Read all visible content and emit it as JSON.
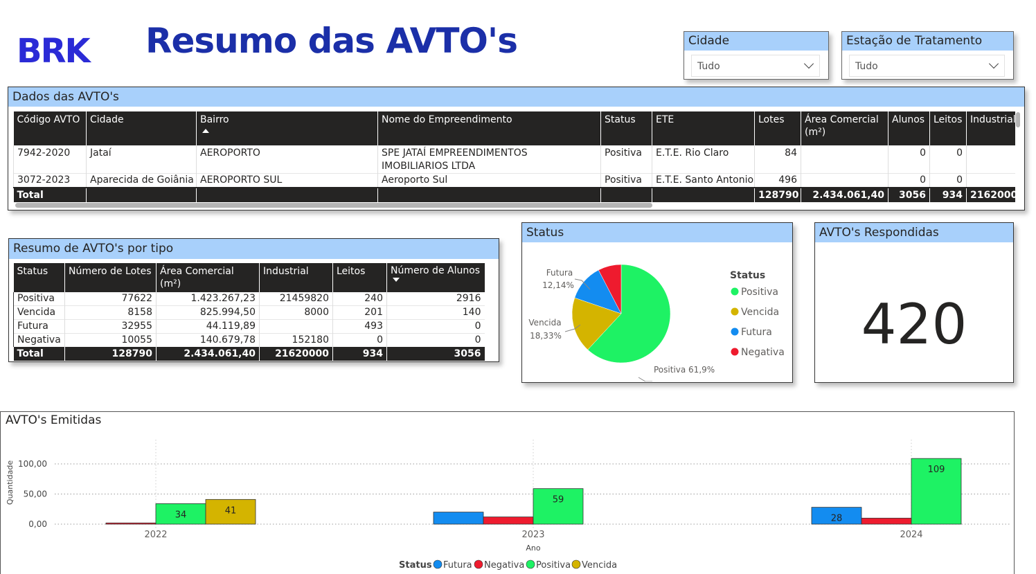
{
  "header": {
    "logo_text": "BRK",
    "title": "Resumo das AVTO's"
  },
  "slicers": {
    "cidade": {
      "label": "Cidade",
      "value": "Tudo"
    },
    "estacao": {
      "label": "Estação de Tratamento",
      "value": "Tudo"
    }
  },
  "colors": {
    "title_blue": "#1b2fa8",
    "header_bg": "#a8d0fb",
    "positiva": "#1ef264",
    "vencida": "#d4b400",
    "futura": "#138cf0",
    "negativa": "#ee1b2e"
  },
  "dados": {
    "title": "Dados das AVTO's",
    "columns": [
      "Código AVTO",
      "Cidade",
      "Bairro",
      "Nome do Empreendimento",
      "Status",
      "ETE",
      "Lotes",
      "Área Comercial (m²)",
      "Alunos",
      "Leitos",
      "Industrial"
    ],
    "rows": [
      [
        "7942-2020",
        "Jataí",
        "AEROPORTO",
        "SPE JATAÍ EMPREENDIMENTOS",
        "IMOBILIARIOS LTDA",
        "Positiva",
        "E.T.E. Rio Claro",
        "84",
        "",
        "0",
        "0",
        ""
      ],
      [
        "3072-2023",
        "Aparecida de Goiânia",
        "AEROPORTO SUL",
        "Aeroporto Sul",
        "",
        "Positiva",
        "E.T.E. Santo Antonio",
        "496",
        "",
        "0",
        "0",
        ""
      ]
    ],
    "total": [
      "Total",
      "",
      "",
      "",
      "",
      "",
      "128790",
      "2.434.061,40",
      "3056",
      "934",
      "2162000"
    ]
  },
  "resumo": {
    "title": "Resumo de AVTO's por tipo",
    "columns": [
      "Status",
      "Número de Lotes",
      "Área Comercial (m²)",
      "Industrial",
      "Leitos",
      "Número de Alunos"
    ],
    "rows": [
      [
        "Positiva",
        "77622",
        "1.423.267,23",
        "21459820",
        "240",
        "2916"
      ],
      [
        "Vencida",
        "8158",
        "825.994,50",
        "8000",
        "201",
        "140"
      ],
      [
        "Futura",
        "32955",
        "44.119,89",
        "",
        "493",
        "0"
      ],
      [
        "Negativa",
        "10055",
        "140.679,78",
        "152180",
        "0",
        "0"
      ]
    ],
    "total": [
      "Total",
      "128790",
      "2.434.061,40",
      "21620000",
      "934",
      "3056"
    ]
  },
  "status_card": {
    "title": "Status",
    "legend_title": "Status",
    "legend": [
      "Positiva",
      "Vencida",
      "Futura",
      "Negativa"
    ],
    "labels": {
      "futura_name": "Futura",
      "futura_pct": "12,14%",
      "vencida_name": "Vencida",
      "vencida_pct": "18,33%",
      "positiva": "Positiva 61,9%"
    }
  },
  "kpi": {
    "title": "AVTO's Respondidas",
    "value": "420"
  },
  "chart_data": {
    "type": "bar",
    "title": "AVTO's Emitidas",
    "xlabel": "Ano",
    "ylabel": "Quantidade",
    "categories": [
      "2022",
      "2023",
      "2024"
    ],
    "y_ticks": [
      "0,00",
      "50,00",
      "100,00"
    ],
    "ylim": [
      0,
      110
    ],
    "grid": true,
    "legend_title": "Status",
    "legend_position": "bottom",
    "series": [
      {
        "name": "Futura",
        "color": "#138cf0",
        "values": [
          0,
          20,
          28
        ]
      },
      {
        "name": "Negativa",
        "color": "#ee1b2e",
        "values": [
          2,
          12,
          10
        ]
      },
      {
        "name": "Positiva",
        "color": "#1ef264",
        "values": [
          34,
          59,
          109
        ]
      },
      {
        "name": "Vencida",
        "color": "#d4b400",
        "values": [
          41,
          0,
          0
        ]
      }
    ],
    "data_labels": [
      {
        "series": "Futura",
        "category": "2024",
        "text": "28"
      },
      {
        "series": "Positiva",
        "category": "2022",
        "text": "34"
      },
      {
        "series": "Positiva",
        "category": "2023",
        "text": "59"
      },
      {
        "series": "Positiva",
        "category": "2024",
        "text": "109"
      },
      {
        "series": "Vencida",
        "category": "2022",
        "text": "41"
      }
    ]
  }
}
